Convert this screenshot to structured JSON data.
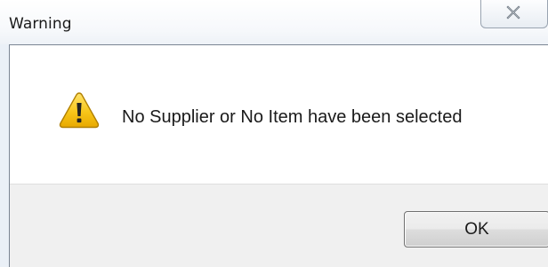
{
  "dialog": {
    "title": "Warning",
    "close_icon": "close-icon",
    "warning_icon": "warning-icon",
    "message": "No Supplier or No Item have been selected",
    "ok_label": "OK"
  },
  "colors": {
    "warning_yellow": "#f5c100",
    "warning_outline": "#b88a00",
    "client_gray": "#f0f0f0",
    "content_white": "#ffffff"
  }
}
